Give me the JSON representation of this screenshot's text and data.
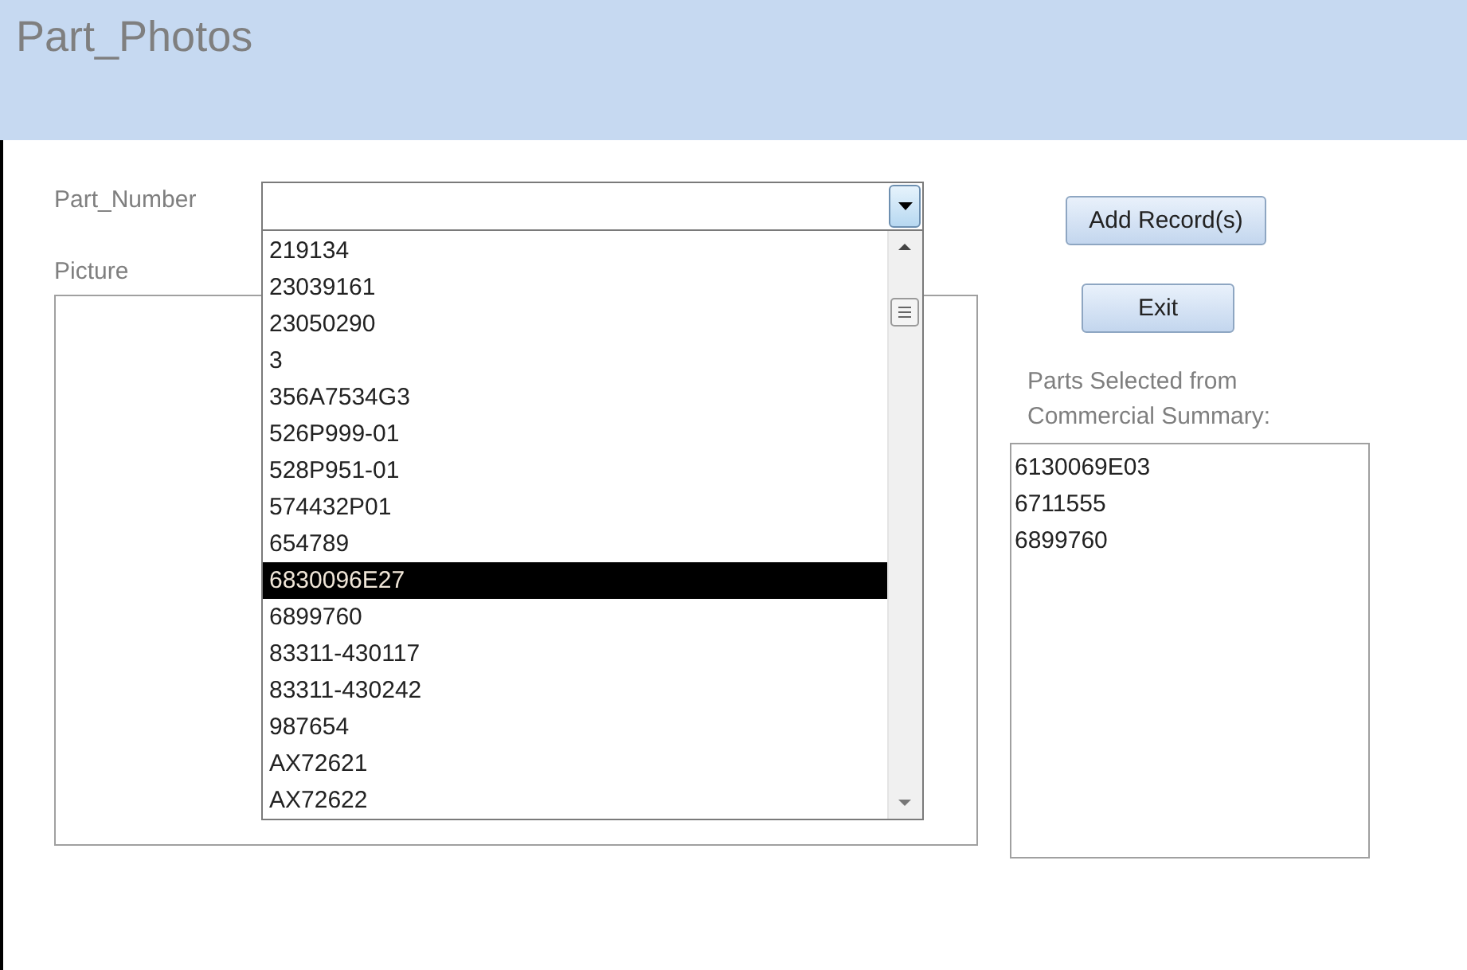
{
  "window": {
    "title": "Part_Photos"
  },
  "part_number": {
    "label": "Part_Number",
    "dropdown_items": [
      {
        "text": "219134",
        "selected": false
      },
      {
        "text": "23039161",
        "selected": false
      },
      {
        "text": "23050290",
        "selected": false
      },
      {
        "text": "3",
        "selected": false
      },
      {
        "text": "356A7534G3",
        "selected": false
      },
      {
        "text": "526P999-01",
        "selected": false
      },
      {
        "text": "528P951-01",
        "selected": false
      },
      {
        "text": "574432P01",
        "selected": false
      },
      {
        "text": "654789",
        "selected": false
      },
      {
        "text": "6830096E27",
        "selected": true
      },
      {
        "text": "6899760",
        "selected": false
      },
      {
        "text": "83311-430117",
        "selected": false
      },
      {
        "text": "83311-430242",
        "selected": false
      },
      {
        "text": "987654",
        "selected": false
      },
      {
        "text": "AX72621",
        "selected": false
      },
      {
        "text": "AX72622",
        "selected": false
      }
    ]
  },
  "picture": {
    "label": "Picture"
  },
  "buttons": [
    "Add Record(s)",
    "Exit"
  ],
  "parts_selected": {
    "label": "Parts Selected from Commercial Summary:",
    "items": [
      "6130069E03",
      "6711555",
      "6899760"
    ]
  }
}
